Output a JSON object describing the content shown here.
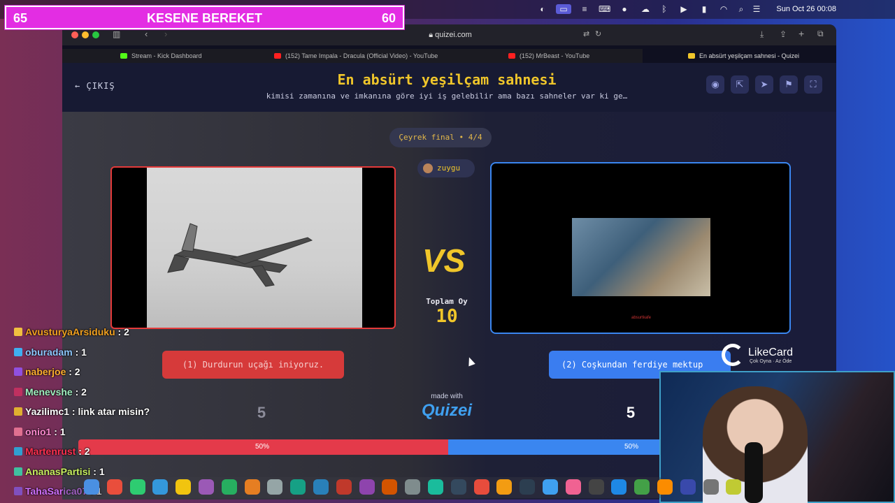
{
  "banner": {
    "left": "65",
    "title": "KESENE BEREKET",
    "right": "60"
  },
  "menubar": {
    "datetime": "Sun Oct 26  00:08"
  },
  "browser": {
    "url": "quizei.com",
    "tabs": [
      {
        "label": "Stream - Kick Dashboard",
        "color": "#53fc18"
      },
      {
        "label": "(152) Tame Impala - Dracula (Official Video) - YouTube",
        "color": "#ff2020"
      },
      {
        "label": "(152) MrBeast - YouTube",
        "color": "#ff2020"
      },
      {
        "label": "En absürt yeşilçam sahnesi - Quizei",
        "color": "#f0c62a"
      }
    ]
  },
  "quiz": {
    "exit_label": "ÇIKIŞ",
    "title": "En absürt yeşilçam sahnesi",
    "subtitle": "kimisi zamanına ve imkanına göre iyi iş gelebilir ama bazı sahneler var ki ge…",
    "round": "Çeyrek final • 4/4",
    "user": "zuygu",
    "vs": "VS",
    "total_label": "Toplam Oy",
    "total_votes": "10",
    "left_option": "(1) Durdurun uçağı iniyoruz.",
    "right_option": "(2) Coşkundan ferdiye mektup",
    "right_watermark": "absurtkafe",
    "left_votes": "5",
    "right_votes": "5",
    "left_share": 50,
    "right_share": 50,
    "left_pct_label": "50%",
    "right_pct_label": "50%",
    "made_with": "made with",
    "brand": "Quizei",
    "accent_red": "#e43a4a",
    "accent_blue": "#3a86f0",
    "accent_gold": "#f0c62a"
  },
  "chat": [
    {
      "user": "AvusturyaArsiduku",
      "msg": ": 2",
      "color": "#f0a020"
    },
    {
      "user": "oburadam",
      "msg": ": 1",
      "color": "#8ec8ff"
    },
    {
      "user": "naberjoe",
      "msg": ": 2",
      "color": "#ffb030"
    },
    {
      "user": "Menevshe",
      "msg": ": 2",
      "color": "#a0f0c0"
    },
    {
      "user": "Yazilimc1",
      "msg": ": link atar misin?",
      "color": "#ffffff"
    },
    {
      "user": "onio1",
      "msg": ": 1",
      "color": "#ff8ad0"
    },
    {
      "user": "Martenrust",
      "msg": ": 2",
      "color": "#ff3050"
    },
    {
      "user": "AnanasPartisi",
      "msg": ": 1",
      "color": "#c8f060"
    },
    {
      "user": "TahaSarica07",
      "msg": ": 1",
      "color": "#d070ff"
    }
  ],
  "likecard": {
    "name": "LikeCard",
    "tagline": "Çok Oyna · Az Öde"
  },
  "icons": [
    "eye-icon",
    "share-icon",
    "send-icon",
    "flag-icon",
    "fullscreen-icon"
  ]
}
